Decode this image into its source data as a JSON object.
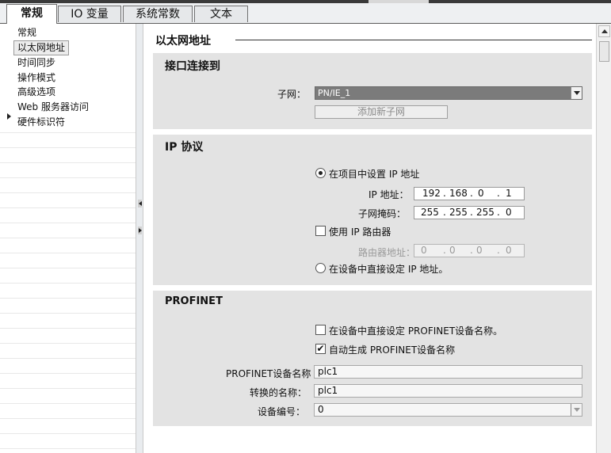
{
  "tabs": [
    {
      "label": "常规",
      "active": true
    },
    {
      "label": "IO 变量",
      "active": false
    },
    {
      "label": "系统常数",
      "active": false
    },
    {
      "label": "文本",
      "active": false
    }
  ],
  "sidebar": {
    "items": [
      {
        "label": "常规"
      },
      {
        "label": "以太网地址",
        "selected": true
      },
      {
        "label": "时间同步"
      },
      {
        "label": "操作模式"
      },
      {
        "label": "高级选项",
        "expandable": true
      },
      {
        "label": "Web 服务器访问"
      },
      {
        "label": "硬件标识符"
      }
    ]
  },
  "section": {
    "title": "以太网地址"
  },
  "interface": {
    "title": "接口连接到",
    "subnet_label": "子网：",
    "subnet_value": "PN/IE_1",
    "add_subnet_button": "添加新子网"
  },
  "ip_protocol": {
    "title": "IP 协议",
    "radio_set_in_project": "在项目中设置 IP 地址",
    "ip_label": "IP 地址：",
    "ip": [
      "192",
      "168",
      "0",
      "1"
    ],
    "mask_label": "子网掩码：",
    "mask": [
      "255",
      "255",
      "255",
      "0"
    ],
    "use_router_label": "使用 IP 路由器",
    "router_label": "路由器地址：",
    "router": [
      "0",
      "0",
      "0",
      "0"
    ],
    "radio_set_on_device": "在设备中直接设定 IP 地址。"
  },
  "profinet": {
    "title": "PROFINET",
    "check_set_on_device": "在设备中直接设定 PROFINET设备名称。",
    "check_auto_generate": "自动生成 PROFINET设备名称",
    "device_name_label": "PROFINET设备名称",
    "device_name_value": "plc1",
    "converted_name_label": "转换的名称：",
    "converted_name_value": "plc1",
    "device_number_label": "设备编号：",
    "device_number_value": "0",
    "checkmark": "✔"
  },
  "colors": {
    "panel_bg": "#e3e3e3",
    "subnet_select_bg": "#7b7b7b"
  }
}
